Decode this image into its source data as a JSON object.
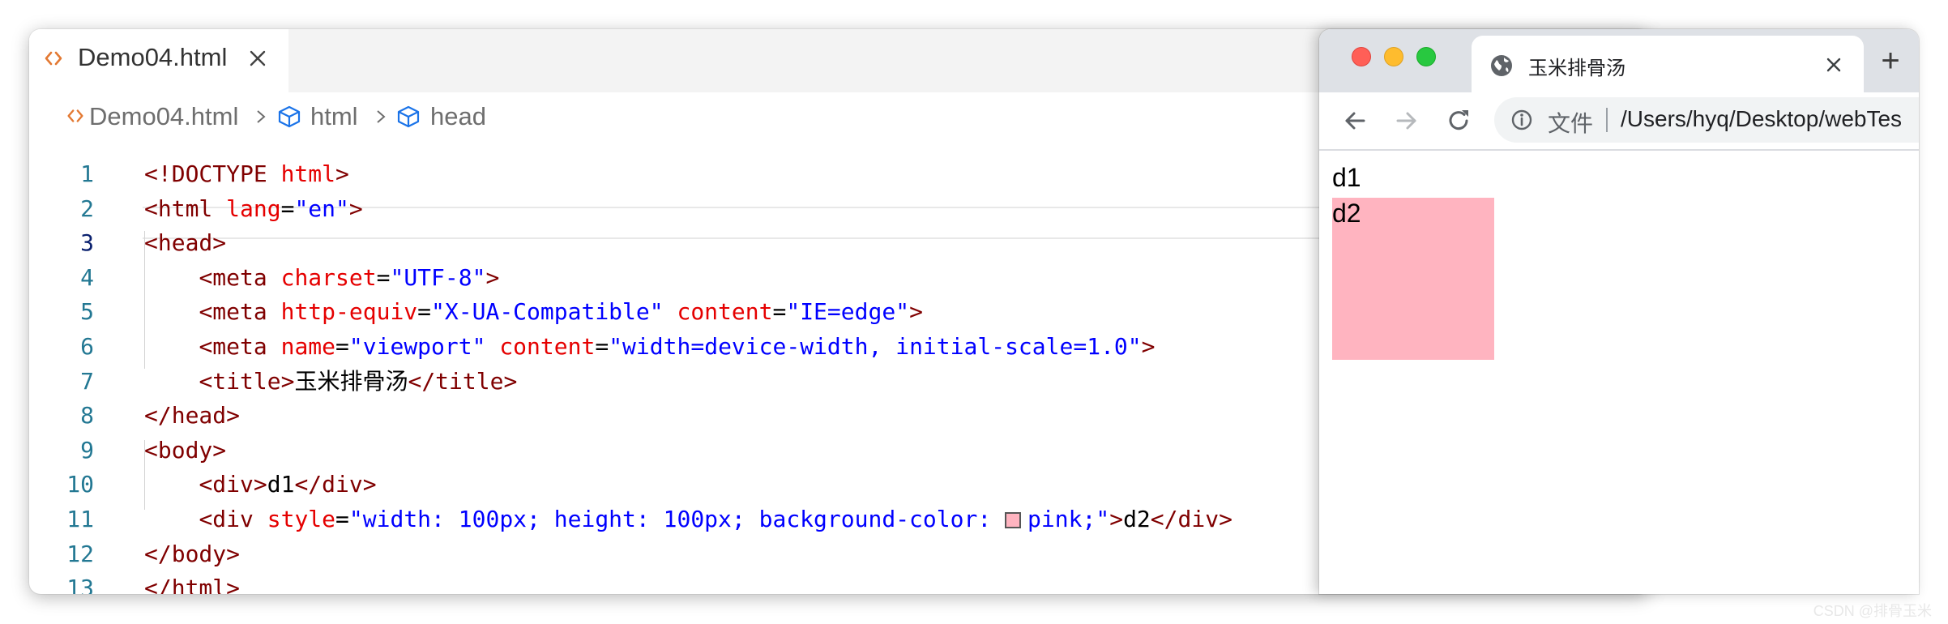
{
  "editor": {
    "tab_label": "Demo04.html",
    "breadcrumb": [
      "Demo04.html",
      "html",
      "head"
    ],
    "active_line": 3,
    "lines": [
      {
        "num": "1",
        "tokens": [
          [
            "tag",
            "<!DOCTYPE "
          ],
          [
            "attr",
            "html"
          ],
          [
            "tag",
            ">"
          ]
        ]
      },
      {
        "num": "2",
        "tokens": [
          [
            "tag",
            "<html "
          ],
          [
            "attr",
            "lang"
          ],
          [
            "txt",
            "="
          ],
          [
            "str",
            "\"en\""
          ],
          [
            "tag",
            ">"
          ]
        ]
      },
      {
        "num": "3",
        "tokens": [
          [
            "tag",
            "<head>"
          ]
        ]
      },
      {
        "num": "4",
        "tokens": [
          [
            "txt",
            "    "
          ],
          [
            "tag",
            "<meta "
          ],
          [
            "attr",
            "charset"
          ],
          [
            "txt",
            "="
          ],
          [
            "str",
            "\"UTF-8\""
          ],
          [
            "tag",
            ">"
          ]
        ]
      },
      {
        "num": "5",
        "tokens": [
          [
            "txt",
            "    "
          ],
          [
            "tag",
            "<meta "
          ],
          [
            "attr",
            "http-equiv"
          ],
          [
            "txt",
            "="
          ],
          [
            "str",
            "\"X-UA-Compatible\""
          ],
          [
            "txt",
            " "
          ],
          [
            "attr",
            "content"
          ],
          [
            "txt",
            "="
          ],
          [
            "str",
            "\"IE=edge\""
          ],
          [
            "tag",
            ">"
          ]
        ]
      },
      {
        "num": "6",
        "tokens": [
          [
            "txt",
            "    "
          ],
          [
            "tag",
            "<meta "
          ],
          [
            "attr",
            "name"
          ],
          [
            "txt",
            "="
          ],
          [
            "str",
            "\"viewport\""
          ],
          [
            "txt",
            " "
          ],
          [
            "attr",
            "content"
          ],
          [
            "txt",
            "="
          ],
          [
            "str",
            "\"width=device-width, initial-scale=1.0\""
          ],
          [
            "tag",
            ">"
          ]
        ]
      },
      {
        "num": "7",
        "tokens": [
          [
            "txt",
            "    "
          ],
          [
            "tag",
            "<title>"
          ],
          [
            "txt",
            "玉米排骨汤"
          ],
          [
            "tag",
            "</title>"
          ]
        ]
      },
      {
        "num": "8",
        "tokens": [
          [
            "tag",
            "</head>"
          ]
        ]
      },
      {
        "num": "9",
        "tokens": [
          [
            "tag",
            "<body>"
          ]
        ]
      },
      {
        "num": "10",
        "tokens": [
          [
            "txt",
            "    "
          ],
          [
            "tag",
            "<div>"
          ],
          [
            "txt",
            "d1"
          ],
          [
            "tag",
            "</div>"
          ]
        ]
      },
      {
        "num": "11",
        "tokens": [
          [
            "txt",
            "    "
          ],
          [
            "tag",
            "<div "
          ],
          [
            "attr",
            "style"
          ],
          [
            "txt",
            "="
          ],
          [
            "str",
            "\"width: 100px; height: 100px; background-color: "
          ],
          [
            "swatch",
            "#ffb4c0"
          ],
          [
            "str",
            "pink;\""
          ],
          [
            "tag",
            ">"
          ],
          [
            "txt",
            "d2"
          ],
          [
            "tag",
            "</div>"
          ]
        ]
      },
      {
        "num": "12",
        "tokens": [
          [
            "tag",
            "</body>"
          ]
        ]
      },
      {
        "num": "13",
        "tokens": [
          [
            "tag",
            "</html>"
          ]
        ]
      }
    ]
  },
  "browser": {
    "tab_title": "玉米排骨汤",
    "new_tab_label": "+",
    "url_scheme_label": "文件",
    "url": "/Users/hyq/Desktop/webTes",
    "page": {
      "d1_text": "d1",
      "d2_text": "d2",
      "d2_color": "#ffb4c0"
    }
  },
  "colors": {
    "tag": "#800000",
    "attr": "#e50000",
    "string": "#0000ff",
    "line_number": "#237893",
    "traffic_close": "#ff5f57",
    "traffic_minimize": "#febc2e",
    "traffic_zoom": "#28c840"
  },
  "watermark": "CSDN @排骨玉米"
}
